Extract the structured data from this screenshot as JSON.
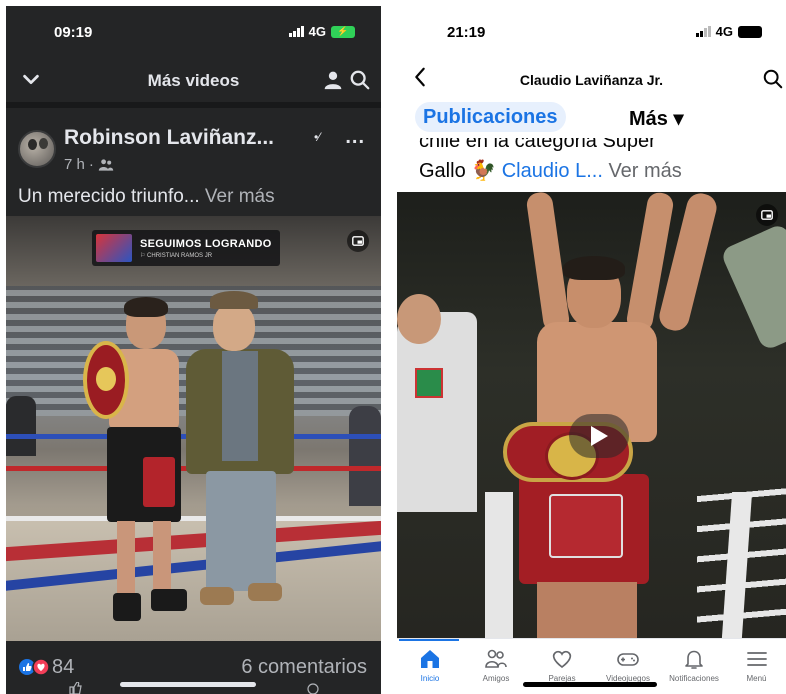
{
  "left": {
    "status": {
      "time": "09:19",
      "network": "4G"
    },
    "nav": {
      "title": "Más videos"
    },
    "post": {
      "author": "Robinson Laviñanz...",
      "more": "...",
      "time": "7 h",
      "dot": "·",
      "caption": "Un merecido triunfo...",
      "see_more": " Ver más"
    },
    "overlay": {
      "title": "SEGUIMOS LOGRANDO",
      "subtitle": "⚐ CHRISTIAN RAMOS JR"
    },
    "reactions": {
      "count": "84",
      "comments": "6 comentarios"
    },
    "icons": [
      "chevron-down-icon",
      "person-icon",
      "search-icon",
      "verified-icon",
      "friends-icon",
      "pip-icon",
      "like-icon",
      "love-icon"
    ]
  },
  "right": {
    "status": {
      "time": "21:19",
      "network": "4G"
    },
    "nav": {
      "title": "Claudio Laviñanza Jr."
    },
    "tabs": {
      "posts": "Publicaciones",
      "more": "Más ▾"
    },
    "caption": {
      "line1": "chile en la categoria Super",
      "line2_prefix": "Gallo 🐓 ",
      "link": "Claudio L...",
      "see_more": " Ver más"
    },
    "tabbar": [
      {
        "label": "Inicio",
        "icon": "home-icon"
      },
      {
        "label": "Amigos",
        "icon": "friends-icon"
      },
      {
        "label": "Parejas",
        "icon": "heart-icon"
      },
      {
        "label": "Videojuegos",
        "icon": "gamepad-icon"
      },
      {
        "label": "Notificaciones",
        "icon": "bell-icon"
      },
      {
        "label": "Menú",
        "icon": "menu-icon"
      }
    ]
  },
  "colors": {
    "facebook_blue": "#1b74e4",
    "dark_bg": "#242526",
    "battery_green": "#30d158",
    "belt_red": "#a11e25"
  }
}
